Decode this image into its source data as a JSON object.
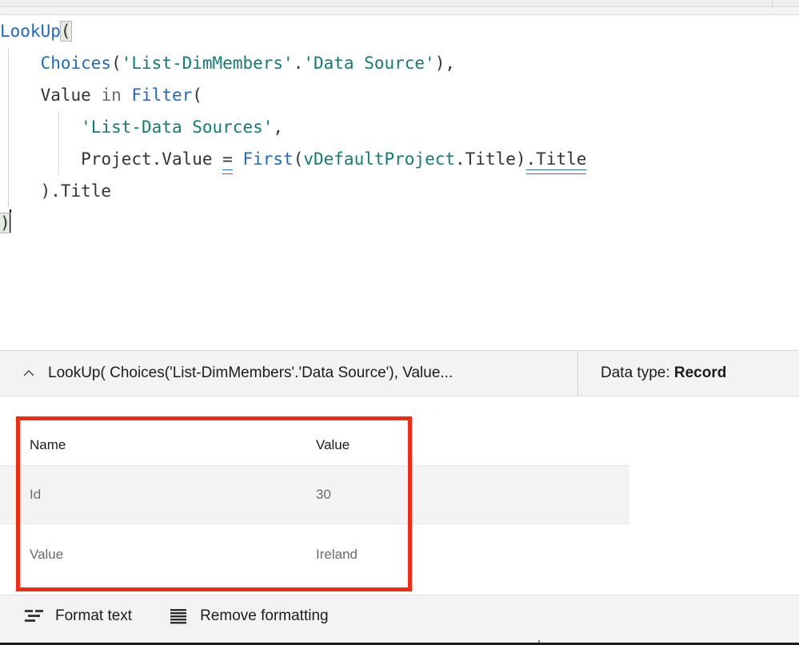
{
  "editor": {
    "language": "PowerFx",
    "lines": [
      {
        "indent": 0,
        "tokens": [
          {
            "t": "LookUp",
            "k": "fn"
          },
          {
            "t": "(",
            "k": "bracket-open"
          }
        ]
      },
      {
        "indent": 1,
        "tokens": [
          {
            "t": "Choices",
            "k": "fn"
          },
          {
            "t": "(",
            "k": "punct"
          },
          {
            "t": "'List-DimMembers'",
            "k": "str"
          },
          {
            "t": ".",
            "k": "punct"
          },
          {
            "t": "'Data Source'",
            "k": "str"
          },
          {
            "t": "),",
            "k": "punct"
          }
        ]
      },
      {
        "indent": 1,
        "tokens": [
          {
            "t": "Value ",
            "k": "ident"
          },
          {
            "t": "in",
            "k": "kw"
          },
          {
            "t": " ",
            "k": "ident"
          },
          {
            "t": "Filter",
            "k": "fn"
          },
          {
            "t": "(",
            "k": "punct"
          }
        ]
      },
      {
        "indent": 2,
        "tokens": [
          {
            "t": "'List-Data Sources'",
            "k": "str"
          },
          {
            "t": ",",
            "k": "punct"
          }
        ]
      },
      {
        "indent": 2,
        "tokens": [
          {
            "t": "Project.Value ",
            "k": "ident"
          },
          {
            "t": "=",
            "k": "eq-warn"
          },
          {
            "t": " ",
            "k": "ident"
          },
          {
            "t": "First",
            "k": "fn"
          },
          {
            "t": "(",
            "k": "punct"
          },
          {
            "t": "vDefaultProject",
            "k": "var"
          },
          {
            "t": ".Title)",
            "k": "punct"
          },
          {
            "t": ".Title",
            "k": "warn"
          }
        ]
      },
      {
        "indent": 1,
        "tokens": [
          {
            "t": ").Title",
            "k": "punct"
          }
        ]
      },
      {
        "indent": 0,
        "tokens": [
          {
            "t": ")",
            "k": "bracket-close"
          }
        ]
      }
    ]
  },
  "summary": {
    "collapse_icon": "chevron-up-icon",
    "formula_text": "LookUp( Choices('List-DimMembers'.'Data Source'), Value...",
    "data_type_label": "Data type: ",
    "data_type_value": "Record"
  },
  "result_table": {
    "columns": [
      "Name",
      "Value"
    ],
    "rows": [
      {
        "name": "Id",
        "value": "30"
      },
      {
        "name": "Value",
        "value": "Ireland"
      }
    ]
  },
  "annotation": {
    "color": "#f42b10"
  },
  "toolbar": {
    "format_text_label": "Format text",
    "format_text_icon": "format-text-icon",
    "remove_formatting_label": "Remove formatting",
    "remove_formatting_icon": "remove-formatting-icon"
  },
  "colors": {
    "function": "#1b69c8",
    "string": "#107c77",
    "identifier": "#333333",
    "keyword": "#6e6e6e",
    "warning_underline": "#2a6fd4",
    "annotation_red": "#f42b10",
    "panel_bg": "#f3f3f3"
  }
}
